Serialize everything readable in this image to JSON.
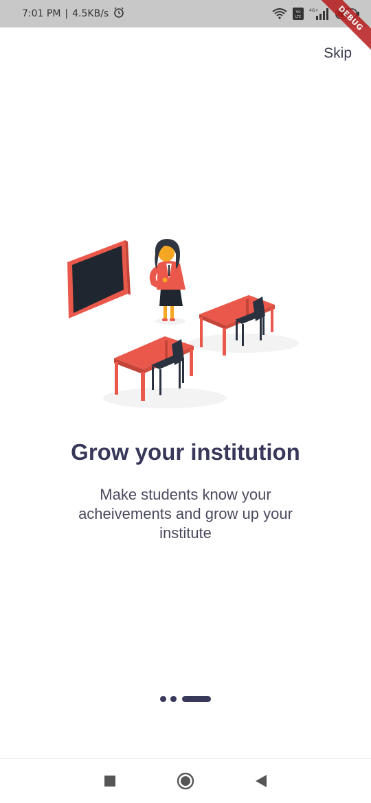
{
  "status_bar": {
    "time": "7:01 PM",
    "separator": "|",
    "net_speed": "4.5KB/s",
    "battery": "55",
    "debug_banner": "DEBUG"
  },
  "header": {
    "skip_label": "Skip"
  },
  "onboarding": {
    "title": "Grow your institution",
    "description": "Make students know your acheivements and grow up your institute",
    "page_index": 3,
    "page_count": 3
  },
  "colors": {
    "accent": "#38385a",
    "desk": "#e9584a",
    "board_frame": "#e9584a",
    "board": "#1f2630",
    "chair": "#2a3240",
    "status_bar": "#c8c8c8"
  },
  "nav": {
    "items": [
      "recents-square-icon",
      "home-circle-icon",
      "back-triangle-icon"
    ]
  }
}
